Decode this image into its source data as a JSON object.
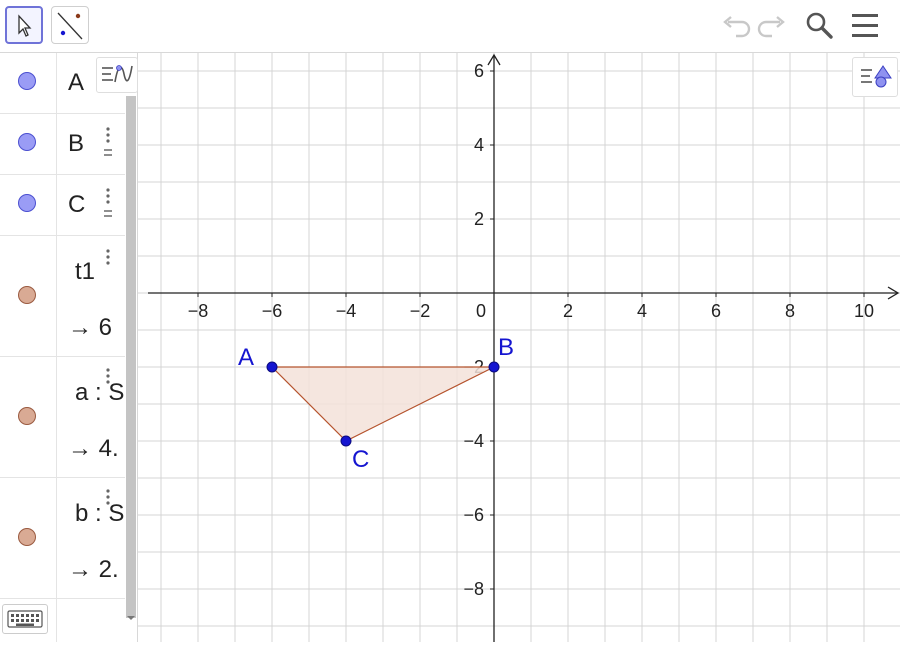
{
  "toolbar": {
    "tools": [
      {
        "name": "move-tool",
        "icon": "cursor-arrow-icon",
        "selected": true
      },
      {
        "name": "line-tool",
        "icon": "line-through-points-icon",
        "selected": false
      }
    ],
    "right": [
      {
        "name": "undo",
        "icon": "undo-icon"
      },
      {
        "name": "redo",
        "icon": "redo-icon"
      },
      {
        "name": "search",
        "icon": "search-icon"
      },
      {
        "name": "menu",
        "icon": "hamburger-menu-icon"
      }
    ]
  },
  "algebra": {
    "rows": [
      {
        "kind": "point",
        "expr": "A",
        "output": ""
      },
      {
        "kind": "point",
        "expr": "B",
        "output": ""
      },
      {
        "kind": "point",
        "expr": "C",
        "output": ""
      },
      {
        "kind": "shape",
        "expr": "t1",
        "output": "→ 6"
      },
      {
        "kind": "shape",
        "expr": "a : S",
        "output": "→ 4."
      },
      {
        "kind": "shape",
        "expr": "b : S",
        "output": "→ 2."
      }
    ],
    "colors": {
      "point_fill": "#9a9cf5",
      "shape_fill": "#d9aa94"
    }
  },
  "graphics": {
    "x_ticks": [
      "−8",
      "−6",
      "−4",
      "−2",
      "0",
      "2",
      "4",
      "6",
      "8",
      "10"
    ],
    "y_ticks": [
      "6",
      "4",
      "2",
      "−2",
      "−4",
      "−6",
      "−8"
    ],
    "x_values": [
      -8,
      -6,
      -4,
      -2,
      0,
      2,
      4,
      6,
      8,
      10
    ],
    "y_values": [
      6,
      4,
      2,
      -2,
      -4,
      -6,
      -8
    ],
    "points": [
      {
        "label": "A",
        "x": -6,
        "y": -2
      },
      {
        "label": "B",
        "x": 0,
        "y": -2
      },
      {
        "label": "C",
        "x": -4,
        "y": -4
      }
    ],
    "colors": {
      "point": "#1515d0",
      "polygon_fill": "#f3e2d9",
      "polygon_stroke": "#b5532d",
      "grid": "#d4d4d4",
      "axis": "#222222"
    }
  }
}
